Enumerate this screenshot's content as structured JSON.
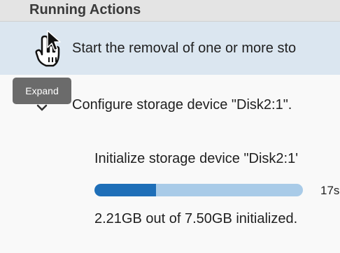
{
  "header": {
    "title": "Running Actions"
  },
  "actions": {
    "removal_label": "Start the removal of one or more sto",
    "expand_tooltip": "Expand",
    "configure_label": "Configure storage device \"Disk2:1\".",
    "initialize_label": "Initialize storage device \"Disk2:1'",
    "progress": {
      "fraction": 0.295,
      "time_remaining": "17s"
    },
    "status_text": "2.21GB out of 7.50GB initialized."
  },
  "icons": {
    "expand": "chevron-down-icon",
    "cursor": "hand-cursor-icon",
    "pointer": "arrow-pointer-icon"
  },
  "colors": {
    "progress_fill": "#1f6fb8",
    "progress_track": "#a9cbe8",
    "highlight_row": "#dbe6f0"
  }
}
